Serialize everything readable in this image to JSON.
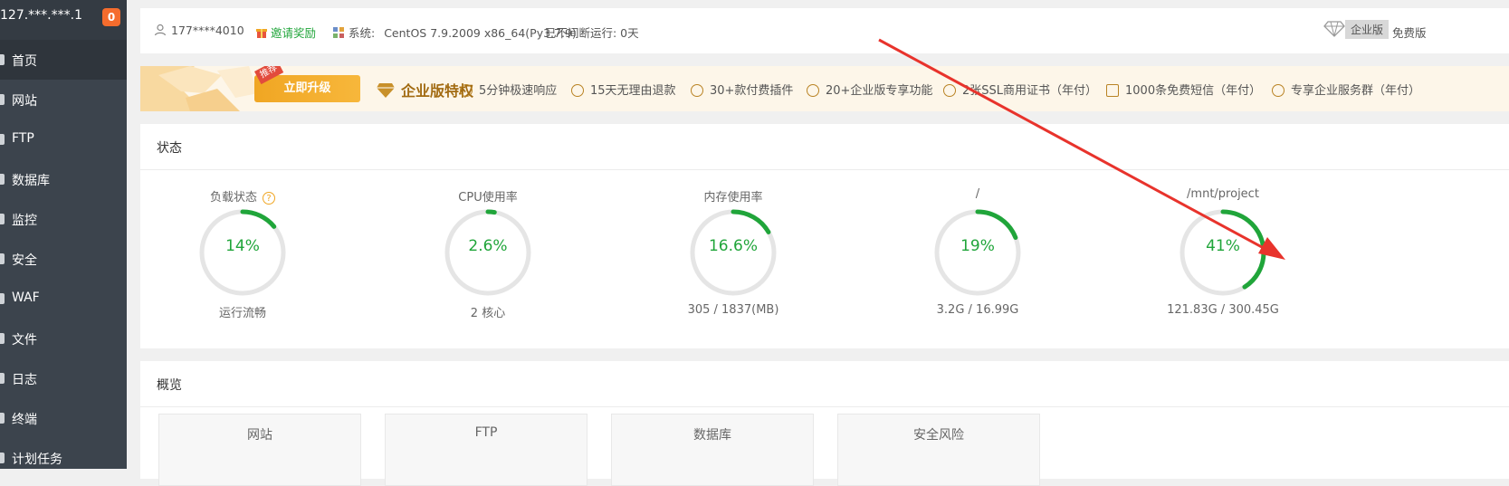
{
  "sidebar": {
    "ip": "127.***.***.1",
    "badge": "0",
    "items": [
      {
        "label": "首页"
      },
      {
        "label": "网站"
      },
      {
        "label": "FTP"
      },
      {
        "label": "数据库"
      },
      {
        "label": "监控"
      },
      {
        "label": "安全"
      },
      {
        "label": "WAF"
      },
      {
        "label": "文件"
      },
      {
        "label": "日志"
      },
      {
        "label": "终端"
      },
      {
        "label": "计划任务"
      }
    ]
  },
  "header": {
    "user": "177****4010",
    "invite": "邀请奖励",
    "system_label": "系统:",
    "system_value": "CentOS 7.9.2009 x86_64(Py3.7.9)",
    "uptime": "已不间断运行: 0天",
    "edition_badge": "企业版",
    "free_label": "免费版"
  },
  "promo": {
    "tag": "推荐",
    "upgrade": "立即升级",
    "title": "企业版特权",
    "perks": [
      "5分钟极速响应",
      "15天无理由退款",
      "30+款付费插件",
      "20+企业版专享功能",
      "2张SSL商用证书（年付）",
      "1000条免费短信（年付）",
      "专享企业服务群（年付）"
    ]
  },
  "status": {
    "title": "状态",
    "gauges": [
      {
        "label": "负载状态",
        "value": "14%",
        "sub": "运行流畅",
        "percent": 14
      },
      {
        "label": "CPU使用率",
        "value": "2.6%",
        "sub": "2 核心",
        "percent": 2.6
      },
      {
        "label": "内存使用率",
        "value": "16.6%",
        "sub": "305 / 1837(MB)",
        "percent": 16.6
      },
      {
        "label": "/",
        "value": "19%",
        "sub": "3.2G / 16.99G",
        "percent": 19
      },
      {
        "label": "/mnt/project",
        "value": "41%",
        "sub": "121.83G / 300.45G",
        "percent": 41
      }
    ]
  },
  "overview": {
    "title": "概览",
    "tiles": [
      "网站",
      "FTP",
      "数据库",
      "安全风险"
    ]
  },
  "colors": {
    "accent": "#20a53a",
    "sidebar": "#3c444d",
    "arrow": "#e8332c",
    "gold": "#f0a623"
  }
}
